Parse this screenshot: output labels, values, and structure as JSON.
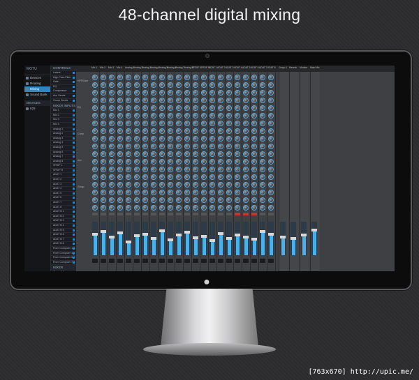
{
  "headline": "48-channel digital mixing",
  "watermark": "[763x670] http://upic.me/",
  "app": {
    "logo": "MOTU",
    "sidebar": {
      "items": [
        {
          "label": "Devices",
          "icon": "device-icon"
        },
        {
          "label": "Routing",
          "icon": "routing-icon"
        },
        {
          "label": "Mixing",
          "icon": "mixer-icon",
          "active": true
        },
        {
          "label": "Sound Bank",
          "icon": "bank-icon"
        }
      ],
      "section_devices": "DEVICES",
      "device_name": "828"
    },
    "channels": {
      "header_controls": "CONTROLS",
      "controls": [
        "Labels",
        "High Pass Filter",
        "Gate",
        "EQ",
        "Compressor",
        "Aux Sends",
        "Group Sends"
      ],
      "header_inputs": "MIXER INPUTS",
      "inputs": [
        "Mic 1",
        "Mic 2",
        "Mic 3",
        "Mic 4",
        "Analog 1",
        "Analog 2",
        "Analog 3",
        "Analog 4",
        "Analog 5",
        "Analog 6",
        "Analog 7",
        "Analog 8",
        "SPDIF L",
        "SPDIF R",
        "ADAT 1",
        "ADAT 2",
        "ADAT 3",
        "ADAT 4",
        "ADAT 5",
        "ADAT 6",
        "ADAT 7",
        "ADAT 8",
        "ADAT B 1",
        "ADAT B 2",
        "ADAT B 3",
        "ADAT B 4",
        "ADAT B 5",
        "ADAT B 6",
        "ADAT B 7",
        "ADAT B 8",
        "From Computer 1-2",
        "From Computer 3-4",
        "From Computer 5-6",
        "From Computer 7-8"
      ],
      "header_outputs": "MIXER OUTPUTS",
      "outputs": [
        "Group 1-2",
        "Group 3-4",
        "Group 5-6",
        "Aux 1-2",
        "Aux 3-4"
      ]
    },
    "strip_labels": [
      "Mic 1",
      "Mic 2",
      "Mic 3",
      "Mic 4",
      "Analog 1",
      "Analog 2",
      "Analog 3",
      "Analog 4",
      "Analog 5",
      "Analog 6",
      "Analog 7",
      "Analog 8",
      "SPDIF L",
      "SPDIF R",
      "ADAT 1",
      "ADAT 2",
      "ADAT 3",
      "ADAT 4",
      "ADAT 5",
      "ADAT 6",
      "ADAT 7",
      "ADAT 8",
      "Group 1",
      "Reverb",
      "Monitor",
      "Main Mix"
    ],
    "row_labels": [
      "HPF/Gate",
      "EQ",
      "Comp",
      "Aux",
      "Group"
    ],
    "master_label": "Main Mix",
    "fader_levels": [
      0.62,
      0.7,
      0.55,
      0.66,
      0.4,
      0.58,
      0.63,
      0.5,
      0.72,
      0.46,
      0.6,
      0.68,
      0.52,
      0.57,
      0.44,
      0.65,
      0.5,
      0.6,
      0.55,
      0.48,
      0.7,
      0.62
    ],
    "muted_strips": [
      17,
      18,
      19
    ]
  }
}
